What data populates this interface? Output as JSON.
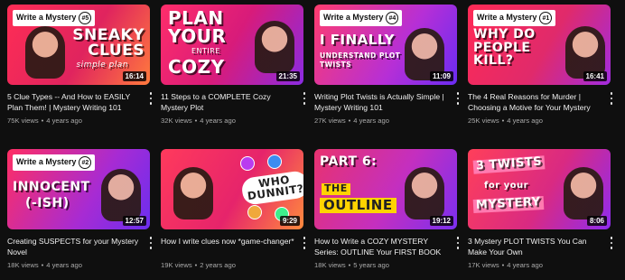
{
  "videos": [
    {
      "tag": "Write a Mystery",
      "tag_num": "#5",
      "headline": [
        "SNEAKY",
        "CLUES"
      ],
      "sub": "simple plan",
      "duration": "16:14",
      "title": "5 Clue Types -- And How to EASILY Plan Them! | Mystery Writing 101",
      "views": "75K views",
      "age": "4 years ago",
      "bg": "#e0245e"
    },
    {
      "tag": "",
      "tag_num": "",
      "headline": [
        "PLAN",
        "YOUR",
        "COZY"
      ],
      "sub": "ENTIRE",
      "duration": "21:35",
      "title": "11 Steps to a COMPLETE Cozy Mystery Plot",
      "views": "32K views",
      "age": "4 years ago",
      "bg": "#d81b7a"
    },
    {
      "tag": "Write a Mystery",
      "tag_num": "#4",
      "headline": [
        "I FINALLY"
      ],
      "sub": "UNDERSTAND PLOT TWISTS",
      "duration": "11:09",
      "title": "Writing Plot Twists is Actually Simple | Mystery Writing 101",
      "views": "27K views",
      "age": "4 years ago",
      "bg": "#b62fd6"
    },
    {
      "tag": "Write a Mystery",
      "tag_num": "#1",
      "headline": [
        "WHY DO",
        "PEOPLE",
        "KILL?"
      ],
      "sub": "",
      "duration": "16:41",
      "title": "The 4 Real Reasons for Murder | Choosing a Motive for Your Mystery",
      "views": "25K views",
      "age": "4 years ago",
      "bg": "#e02a6b"
    },
    {
      "tag": "Write a Mystery",
      "tag_num": "#2",
      "headline": [
        "INNOCENT",
        "(-ISH)"
      ],
      "sub": "",
      "duration": "12:57",
      "title": "Creating SUSPECTS for your Mystery Novel",
      "views": "18K views",
      "age": "4 years ago",
      "bg": "#a72bd3"
    },
    {
      "tag": "",
      "tag_num": "",
      "headline": [
        "WHO",
        "DUNNIT?"
      ],
      "sub": "",
      "duration": "9:29",
      "title": "How I write clues now *game-changer*",
      "views": "19K views",
      "age": "2 years ago",
      "bg": "#e6246b"
    },
    {
      "tag": "",
      "tag_num": "",
      "headline": [
        "PART 6:",
        "THE",
        "OUTLINE"
      ],
      "sub": "",
      "duration": "19:12",
      "title": "How to Write a COZY MYSTERY Series: OUTLINE Your FIRST BOOK",
      "views": "18K views",
      "age": "5 years ago",
      "bg": "#c42fbf"
    },
    {
      "tag": "",
      "tag_num": "",
      "headline": [
        "3 TWISTS",
        "for your",
        "MYSTERY"
      ],
      "sub": "",
      "duration": "8:06",
      "title": "3 Mystery PLOT TWISTS You Can Make Your Own",
      "views": "17K views",
      "age": "4 years ago",
      "bg": "#d92a82"
    }
  ]
}
